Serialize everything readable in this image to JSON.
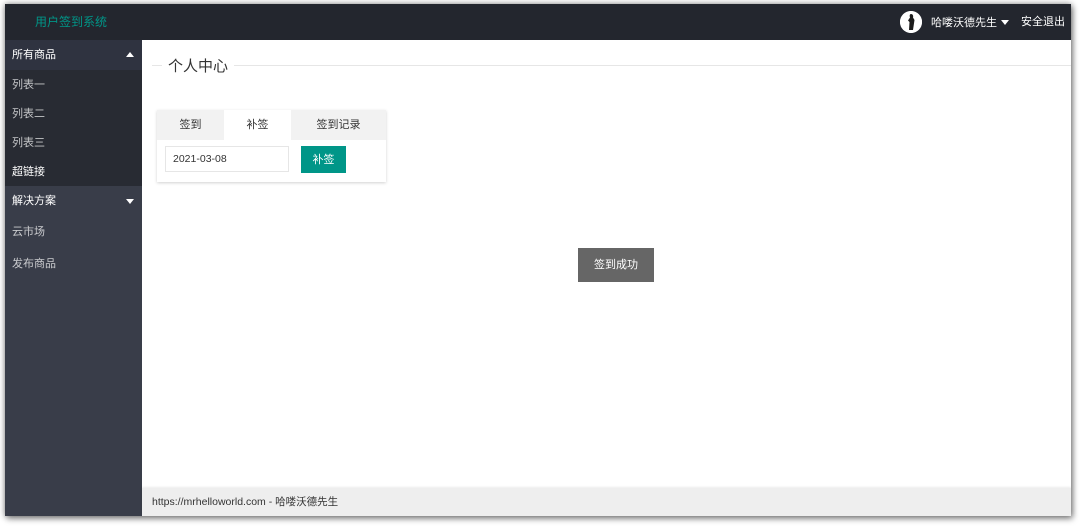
{
  "header": {
    "logo": "用户签到系统",
    "user_name": "哈喽沃德先生",
    "logout": "安全退出"
  },
  "sidebar": {
    "group_products": "所有商品",
    "sub_items": [
      "列表一",
      "列表二",
      "列表三",
      "超链接"
    ],
    "group_solutions": "解决方案",
    "cloud_market": "云市场",
    "publish": "发布商品"
  },
  "main": {
    "title": "个人中心",
    "tabs": [
      "签到",
      "补签",
      "签到记录"
    ],
    "date_value": "2021-03-08",
    "makeup_button": "补签",
    "toast": "签到成功"
  },
  "footer": {
    "text": "https://mrhelloworld.com - 哈喽沃德先生"
  },
  "colors": {
    "header_bg": "#23262e",
    "sidebar_bg": "#393d49",
    "accent": "#009688"
  }
}
